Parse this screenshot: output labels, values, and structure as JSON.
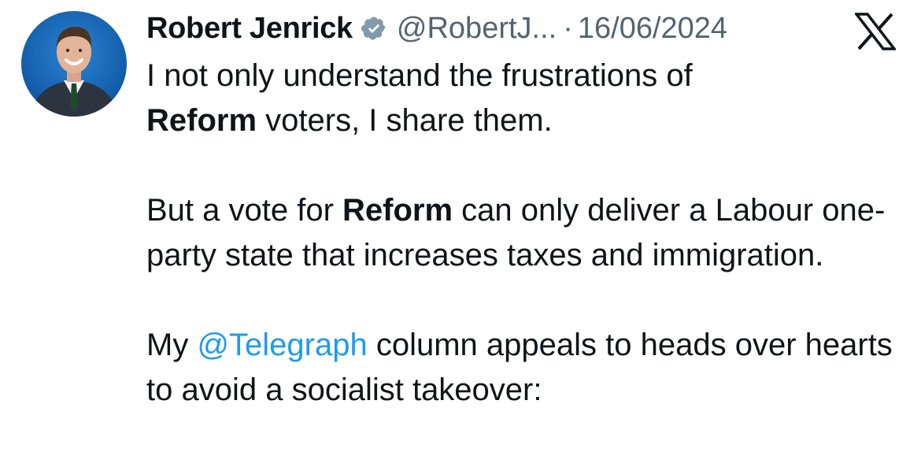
{
  "tweet": {
    "author_name": "Robert Jenrick",
    "handle": "@RobertJ...",
    "separator": "·",
    "date": "16/06/2024",
    "verified_icon": "verified-badge-icon",
    "platform_icon": "x-logo-icon",
    "paragraphs": [
      {
        "line1_a": "I not only understand the frustrations of",
        "line2_bold": "Reform",
        "line2_rest": " voters, I share them."
      },
      {
        "a": "But a vote for ",
        "bold": "Reform",
        "b": " can only deliver a Labour one-party state that increases taxes and immigration."
      },
      {
        "a": "My ",
        "mention": "@Telegraph",
        "b": " column appeals to heads over hearts to avoid a socialist takeover:"
      }
    ]
  },
  "colors": {
    "text": "#0f1419",
    "secondary": "#536471",
    "mention": "#1d9bf0",
    "verified_badge": "#829aab"
  }
}
